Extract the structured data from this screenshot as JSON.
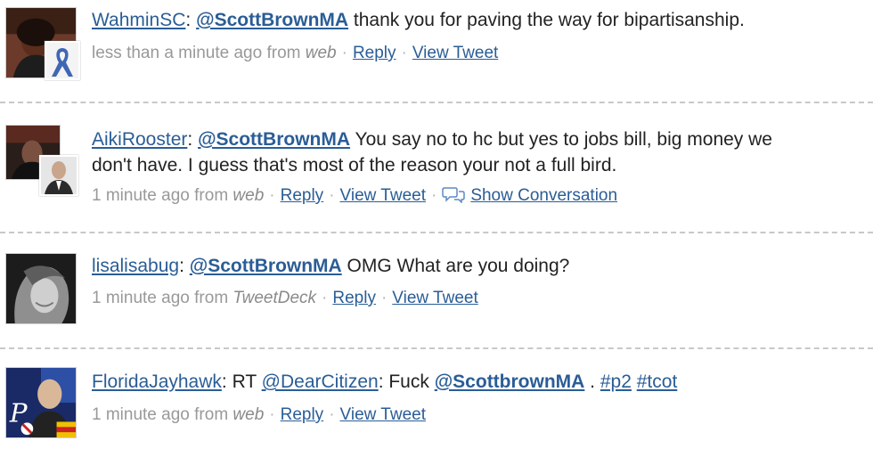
{
  "tweets": [
    {
      "author": "WahminSC",
      "colon": ":",
      "mention": "@ScottBrownMA",
      "text": " thank you for paving the way for bipartisanship.",
      "time": "less than a minute ago",
      "from": "from",
      "source": "web",
      "reply": "Reply",
      "view": "View Tweet",
      "avatar_icon": "user-photo",
      "badge_icon": "blue-ribbon"
    },
    {
      "author": "AikiRooster",
      "colon": ":",
      "mention": "@ScottBrownMA",
      "text_line1": " You say no to hc but yes to jobs bill, big money we",
      "text_line2": "don't have. I guess that's most of the reason your not a full bird.",
      "time": "1 minute ago",
      "from": "from",
      "source": "web",
      "reply": "Reply",
      "view": "View Tweet",
      "conversation": "Show Conversation",
      "avatar_icon": "user-photo",
      "badge_icon": "person-photo"
    },
    {
      "author": "lisalisabug",
      "colon": ":",
      "mention": "@ScottBrownMA",
      "text": " OMG What are you doing?",
      "time": "1 minute ago",
      "from": "from",
      "source": "TweetDeck",
      "reply": "Reply",
      "view": "View Tweet",
      "avatar_icon": "user-photo"
    },
    {
      "author": "FloridaJayhawk",
      "colon": ":",
      "rt": " RT ",
      "rt_mention": "@DearCitizen",
      "rt_colon": ": Fuck ",
      "mention": "@ScottbrownMA",
      "dot": " . ",
      "hashtag1": "#p2",
      "space": " ",
      "hashtag2": "#tcot",
      "time": "1 minute ago",
      "from": "from",
      "source": "web",
      "reply": "Reply",
      "view": "View Tweet",
      "avatar_icon": "collage-photo"
    }
  ],
  "separator": "·",
  "colors": {
    "link": "#2a5d96",
    "meta": "#999999",
    "divider": "#c8c8c8"
  }
}
